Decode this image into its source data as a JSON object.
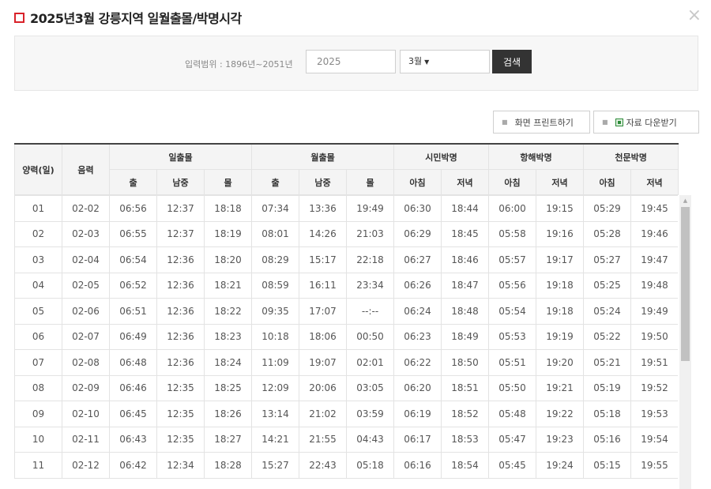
{
  "header": {
    "title": "2025년3월 강릉지역 일월출몰/박명시각",
    "close_label": "×"
  },
  "search": {
    "range_label": "입력범위 : 1896년~2051년",
    "year_value": "2025",
    "month_value": "3월",
    "button_label": "검색"
  },
  "tools": {
    "print_label": "화면 프린트하기",
    "download_label": "자료 다운받기"
  },
  "table": {
    "group_headers": {
      "solar_date": "양력(일)",
      "lunar_date": "음력",
      "sun": "일출몰",
      "moon": "월출몰",
      "civil": "시민박명",
      "nautical": "항해박명",
      "astro": "천문박명"
    },
    "sub_headers": {
      "rise": "출",
      "transit": "남중",
      "set": "몰",
      "morning": "아침",
      "evening": "저녁"
    },
    "rows": [
      [
        "01",
        "02-02",
        "06:56",
        "12:37",
        "18:18",
        "07:34",
        "13:36",
        "19:49",
        "06:30",
        "18:44",
        "06:00",
        "19:15",
        "05:29",
        "19:45"
      ],
      [
        "02",
        "02-03",
        "06:55",
        "12:37",
        "18:19",
        "08:01",
        "14:26",
        "21:03",
        "06:29",
        "18:45",
        "05:58",
        "19:16",
        "05:28",
        "19:46"
      ],
      [
        "03",
        "02-04",
        "06:54",
        "12:36",
        "18:20",
        "08:29",
        "15:17",
        "22:18",
        "06:27",
        "18:46",
        "05:57",
        "19:17",
        "05:27",
        "19:47"
      ],
      [
        "04",
        "02-05",
        "06:52",
        "12:36",
        "18:21",
        "08:59",
        "16:11",
        "23:34",
        "06:26",
        "18:47",
        "05:56",
        "19:18",
        "05:25",
        "19:48"
      ],
      [
        "05",
        "02-06",
        "06:51",
        "12:36",
        "18:22",
        "09:35",
        "17:07",
        "--:--",
        "06:24",
        "18:48",
        "05:54",
        "19:18",
        "05:24",
        "19:49"
      ],
      [
        "06",
        "02-07",
        "06:49",
        "12:36",
        "18:23",
        "10:18",
        "18:06",
        "00:50",
        "06:23",
        "18:49",
        "05:53",
        "19:19",
        "05:22",
        "19:50"
      ],
      [
        "07",
        "02-08",
        "06:48",
        "12:36",
        "18:24",
        "11:09",
        "19:07",
        "02:01",
        "06:22",
        "18:50",
        "05:51",
        "19:20",
        "05:21",
        "19:51"
      ],
      [
        "08",
        "02-09",
        "06:46",
        "12:35",
        "18:25",
        "12:09",
        "20:06",
        "03:05",
        "06:20",
        "18:51",
        "05:50",
        "19:21",
        "05:19",
        "19:52"
      ],
      [
        "09",
        "02-10",
        "06:45",
        "12:35",
        "18:26",
        "13:14",
        "21:02",
        "03:59",
        "06:19",
        "18:52",
        "05:48",
        "19:22",
        "05:18",
        "19:53"
      ],
      [
        "10",
        "02-11",
        "06:43",
        "12:35",
        "18:27",
        "14:21",
        "21:55",
        "04:43",
        "06:17",
        "18:53",
        "05:47",
        "19:23",
        "05:16",
        "19:54"
      ],
      [
        "11",
        "02-12",
        "06:42",
        "12:34",
        "18:28",
        "15:27",
        "22:43",
        "05:18",
        "06:16",
        "18:54",
        "05:45",
        "19:24",
        "05:15",
        "19:55"
      ]
    ]
  }
}
